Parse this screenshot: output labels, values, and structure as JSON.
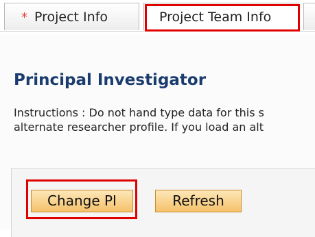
{
  "tabs": [
    {
      "label": "Project Info",
      "required_marker": "*"
    },
    {
      "label": "Project Team Info"
    }
  ],
  "section": {
    "title": "Principal Investigator",
    "instructions_line1": "Instructions : Do not hand type data for this s",
    "instructions_line2": "alternate researcher profile. If you load an alt"
  },
  "buttons": {
    "change_pi": "Change PI",
    "refresh": "Refresh"
  },
  "colors": {
    "highlight": "#e10000",
    "title": "#1a3c6e",
    "button_fill": "#f5c26b"
  }
}
